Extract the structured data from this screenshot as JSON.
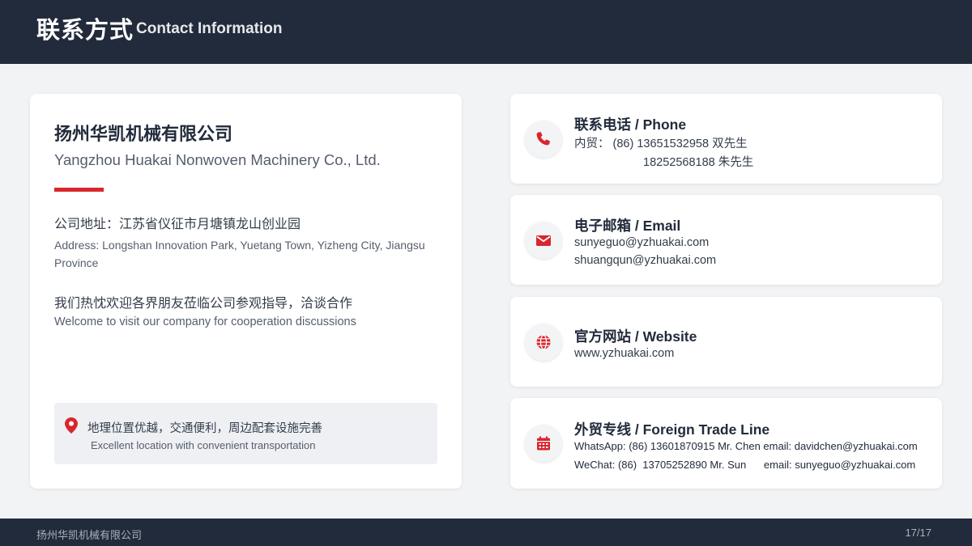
{
  "header": {
    "title_zh": "联系方式",
    "title_en": "Contact Information"
  },
  "company": {
    "name_zh": "扬州华凯机械有限公司",
    "name_en": "Yangzhou Huakai Nonwoven Machinery Co., Ltd.",
    "address_zh": "公司地址：江苏省仪征市月塘镇龙山创业园",
    "address_en": "Address: Longshan Innovation Park, Yuetang Town, Yizheng City, Jiangsu Province",
    "welcome_zh": "我们热忱欢迎各界朋友莅临公司参观指导，洽谈合作",
    "welcome_en": "Welcome to visit our company for cooperation discussions",
    "location_zh": "地理位置优越，交通便利，周边配套设施完善",
    "location_en": "Excellent location with convenient transportation"
  },
  "phone": {
    "title": "联系电话 / Phone",
    "line1": "内贸：  (86) 13651532958 双先生",
    "line2": "18252568188 朱先生"
  },
  "email": {
    "title": "电子邮箱 / Email",
    "line1": "sunyeguo@yzhuakai.com",
    "line2": "shuangqun@yzhuakai.com"
  },
  "website": {
    "title": "官方网站 / Website",
    "line1": "www.yzhuakai.com"
  },
  "trade": {
    "title": "外贸专线 / Foreign Trade Line",
    "line1": "WhatsApp: (86) 13601870915 Mr. Chen  email: davidchen@yzhuakai.com",
    "line2": "WeChat: (86)  13705252890 Mr. Sun      email: sunyeguo@yzhuakai.com"
  },
  "footer": {
    "company": "扬州华凯机械有限公司",
    "page": "17/17"
  },
  "colors": {
    "accent": "#d9262e",
    "dark": "#222b3b",
    "background": "#f2f3f5"
  },
  "icons": [
    "map-pin-icon",
    "phone-icon",
    "mail-icon",
    "globe-icon",
    "calendar-icon"
  ]
}
